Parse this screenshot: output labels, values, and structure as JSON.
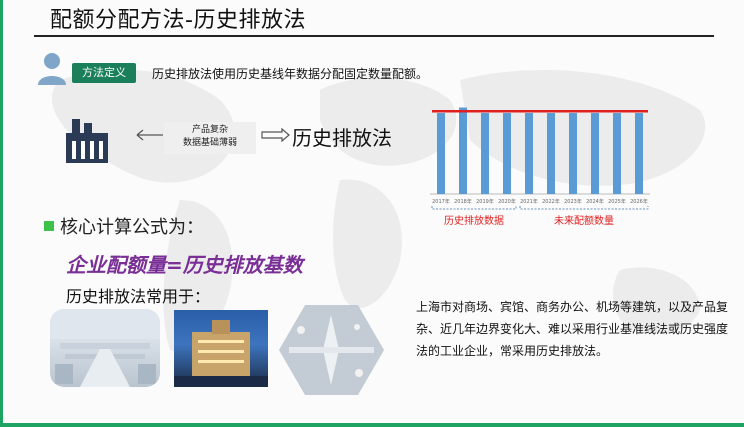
{
  "header": {
    "title": "配额分配方法-历史排放法"
  },
  "definition": {
    "badge": "方法定义",
    "text": "历史排放法使用历史基线年数据分配固定数量配额。"
  },
  "flow": {
    "note_line1": "产品复杂",
    "note_line2": "数据基础薄弱",
    "method": "历史排放法"
  },
  "formula": {
    "heading": "核心计算公式为：",
    "expression": "企业配额量=历史排放基数",
    "usage_label": "历史排放法常用于："
  },
  "description": "上海市对商场、宾馆、商务办公、机场等建筑，以及产品复杂、近几年边界变化大、难以采用行业基准线法或历史强度法的工业企业，常采用历史排放法。",
  "chart_data": {
    "type": "bar",
    "categories": [
      "2017年",
      "2018年",
      "2019年",
      "2020年",
      "2021年",
      "2022年",
      "2023年",
      "2024年",
      "2025年",
      "2026年"
    ],
    "values": [
      88,
      94,
      88,
      88,
      88,
      88,
      88,
      88,
      88,
      88
    ],
    "reference_line": 90,
    "ylim": [
      0,
      100
    ],
    "groups": [
      {
        "label": "历史排放数据",
        "from": 0,
        "to": 3
      },
      {
        "label": "未来配额数量",
        "from": 4,
        "to": 9
      }
    ],
    "bar_color": "#5b9bd5",
    "line_color": "#e02020",
    "group_label_color": "#e02020"
  },
  "colors": {
    "accent": "#1a7f5a",
    "border": "#1fa362",
    "formula": "#7a2f96",
    "bullet": "#3cc24b"
  }
}
